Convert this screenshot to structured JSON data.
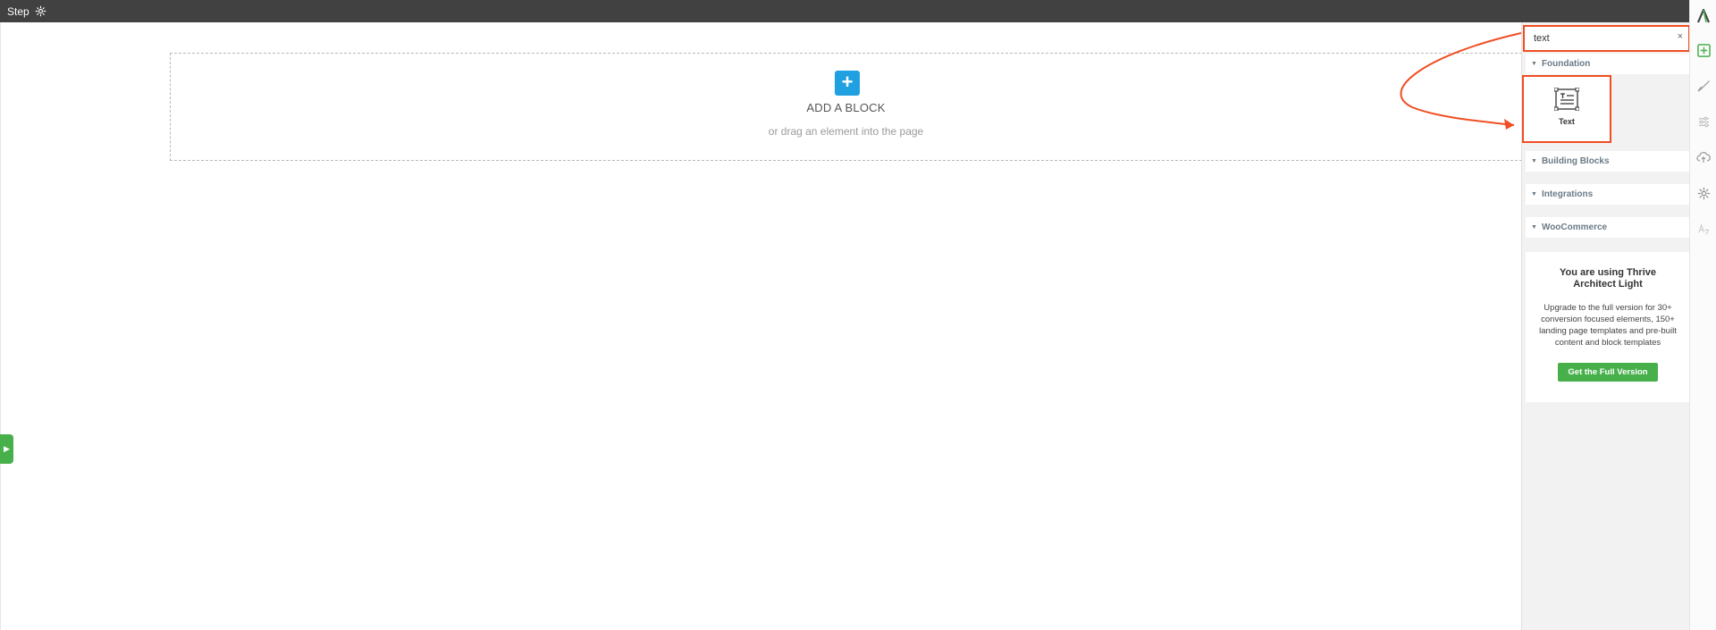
{
  "topbar": {
    "title": "Step",
    "settings_icon": "gear-icon"
  },
  "canvas": {
    "add_block_label": "ADD A BLOCK",
    "add_block_sub": "or drag an element into the page",
    "add_icon": "plus-icon",
    "sidebar_toggle_icon": "chevron-right-icon"
  },
  "panel": {
    "search": {
      "value": "text",
      "clear_label": "×"
    },
    "sections": [
      {
        "label": "Foundation"
      },
      {
        "label": "Building Blocks"
      },
      {
        "label": "Integrations"
      },
      {
        "label": "WooCommerce"
      }
    ],
    "foundation_elements": [
      {
        "label": "Text",
        "icon": "text-element-icon"
      }
    ],
    "promo": {
      "title": "You are using Thrive Architect Light",
      "text": "Upgrade to the full version for 30+ conversion focused elements, 150+ landing page templates and pre-built content and block templates",
      "button_label": "Get the Full Version"
    }
  },
  "rail": {
    "icons": [
      "logo-icon",
      "add-element-icon",
      "brush-icon",
      "sliders-icon",
      "cloud-upload-icon",
      "gear-icon",
      "translate-icon"
    ]
  },
  "colors": {
    "topbar": "#414141",
    "accent_blue": "#1fa0e0",
    "accent_green": "#47b04b",
    "highlight": "#f04e23"
  }
}
